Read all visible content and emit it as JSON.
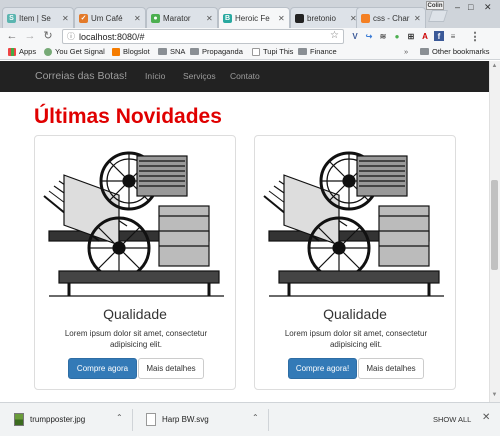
{
  "browser": {
    "tabs": [
      {
        "title": "Item | Se",
        "favicon": "S",
        "fav_color": "#5bb5b0",
        "active": false
      },
      {
        "title": "Um Café",
        "favicon": "✓",
        "fav_color": "#e37a2a",
        "active": false
      },
      {
        "title": "Marator",
        "favicon": "●",
        "fav_color": "#4caf50",
        "active": false
      },
      {
        "title": "Heroic Fe",
        "favicon": "B",
        "fav_color": "#2aa9a0",
        "active": true
      },
      {
        "title": "bretonio",
        "favicon": "●",
        "fav_color": "#222222",
        "active": false
      },
      {
        "title": "css - Char",
        "favicon": "●",
        "fav_color": "#f48024",
        "active": false
      }
    ],
    "profile_label": "Colin",
    "address": "localhost:8080/#",
    "bookmarks": [
      {
        "label": "Apps"
      },
      {
        "label": "You Get Signal"
      },
      {
        "label": "Blogslot"
      },
      {
        "label": "SNA"
      },
      {
        "label": "Propaganda"
      },
      {
        "label": "Tupi This"
      },
      {
        "label": "Finance"
      }
    ],
    "bookmarks_overflow": "»",
    "other_bookmarks": "Other bookmarks"
  },
  "site": {
    "brand": "Correias das Botas!",
    "nav": [
      "Início",
      "Serviços",
      "Contato"
    ],
    "heading": "Últimas Novidades",
    "cards": [
      {
        "title": "Qualidade",
        "text": "Lorem ipsum dolor sit amet, consectetur adipisicing elit.",
        "primary": "Compre agora",
        "secondary": "Mais detalhes"
      },
      {
        "title": "Qualidade",
        "text": "Lorem ipsum dolor sit amet, consectetur adipisicing elit.",
        "primary": "Compre agora!",
        "secondary": "Mais detalhes"
      }
    ]
  },
  "downloads": {
    "items": [
      {
        "name": "trumpposter.jpg",
        "icon": "image-file-icon"
      },
      {
        "name": "Harp BW.svg",
        "icon": "svg-file-icon"
      }
    ],
    "show_all": "SHOW ALL"
  },
  "colors": {
    "heading_red": "#e00000",
    "navbar_bg": "#222222",
    "primary_btn": "#337ab7"
  }
}
